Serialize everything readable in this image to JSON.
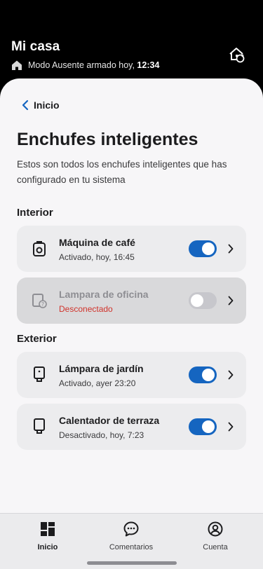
{
  "header": {
    "title": "Mi casa",
    "status_prefix": "Modo Ausente armado hoy, ",
    "status_time": "12:34",
    "home_icon": "home-icon",
    "away_button_icon": "home-sync-icon"
  },
  "nav": {
    "back_label": "Inicio",
    "back_icon": "chevron-left-icon"
  },
  "page": {
    "title": "Enchufes inteligentes",
    "description": "Estos son todos los enchufes inteligentes que has configurado en tu sistema"
  },
  "sections": [
    {
      "title": "Interior",
      "devices": [
        {
          "name": "Máquina de café",
          "status": "Activado, hoy, 16:45",
          "icon": "coffee-machine-icon",
          "on": true,
          "connected": true
        },
        {
          "name": "Lampara de oficina",
          "status": "Desconectado",
          "icon": "plug-disconnected-icon",
          "on": false,
          "connected": false
        }
      ]
    },
    {
      "title": "Exterior",
      "devices": [
        {
          "name": "Lámpara de jardín",
          "status": "Activado, ayer 23:20",
          "icon": "smart-plug-icon",
          "on": true,
          "connected": true
        },
        {
          "name": "Calentador de terraza",
          "status": "Desactivado, hoy, 7:23",
          "icon": "smart-plug-icon",
          "on": true,
          "connected": true
        }
      ]
    }
  ],
  "bottom_nav": {
    "items": [
      {
        "label": "Inicio",
        "icon": "dashboard-icon",
        "active": true
      },
      {
        "label": "Comentarios",
        "icon": "chat-bubble-icon",
        "active": false
      },
      {
        "label": "Cuenta",
        "icon": "account-icon",
        "active": false
      }
    ]
  },
  "colors": {
    "accent": "#1565c0",
    "error": "#d0332b",
    "sheet": "#f7f6f8",
    "card": "#ececee"
  }
}
